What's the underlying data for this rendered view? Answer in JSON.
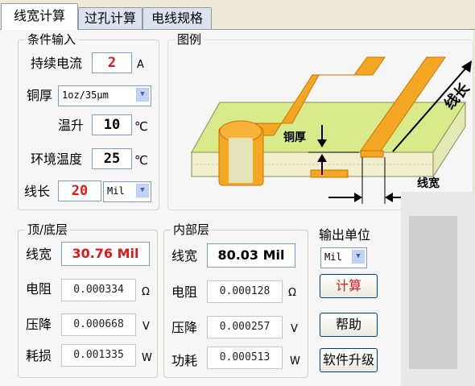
{
  "tabs": [
    "线宽计算",
    "过孔计算",
    "电线规格"
  ],
  "inputs": {
    "title": "条件输入",
    "current_label": "持续电流",
    "current_value": "2",
    "current_unit": "A",
    "copper_label": "铜厚",
    "copper_value": "1oz/35μm",
    "temp_label": "温升",
    "temp_value": "10",
    "temp_unit": "℃",
    "ambient_label": "环境温度",
    "ambient_value": "25",
    "ambient_unit": "℃",
    "length_label": "线长",
    "length_value": "20",
    "length_unit": "Mil"
  },
  "diagram": {
    "title": "图例",
    "copper_label": "铜厚",
    "length_label": "线长",
    "width_label": "线宽"
  },
  "top": {
    "title": "顶/底层",
    "width_label": "线宽",
    "width_value": "30.76 Mil",
    "res_label": "电阻",
    "res_value": "0.000334",
    "res_unit": "Ω",
    "drop_label": "压降",
    "drop_value": "0.000668",
    "drop_unit": "V",
    "loss_label": "耗损",
    "loss_value": "0.001335",
    "loss_unit": "W"
  },
  "inner": {
    "title": "内部层",
    "width_label": "线宽",
    "width_value": "80.03 Mil",
    "res_label": "电阻",
    "res_value": "0.000128",
    "res_unit": "Ω",
    "drop_label": "压降",
    "drop_value": "0.000257",
    "drop_unit": "V",
    "power_label": "功耗",
    "power_value": "0.000513",
    "power_unit": "W"
  },
  "output": {
    "label": "输出单位",
    "value": "Mil"
  },
  "buttons": {
    "calc": "计算",
    "help": "帮助",
    "upgrade": "软件升级"
  },
  "colors": {
    "accent_red": "#e01818",
    "board": "#d9ea8a",
    "copper": "#f5a623"
  }
}
